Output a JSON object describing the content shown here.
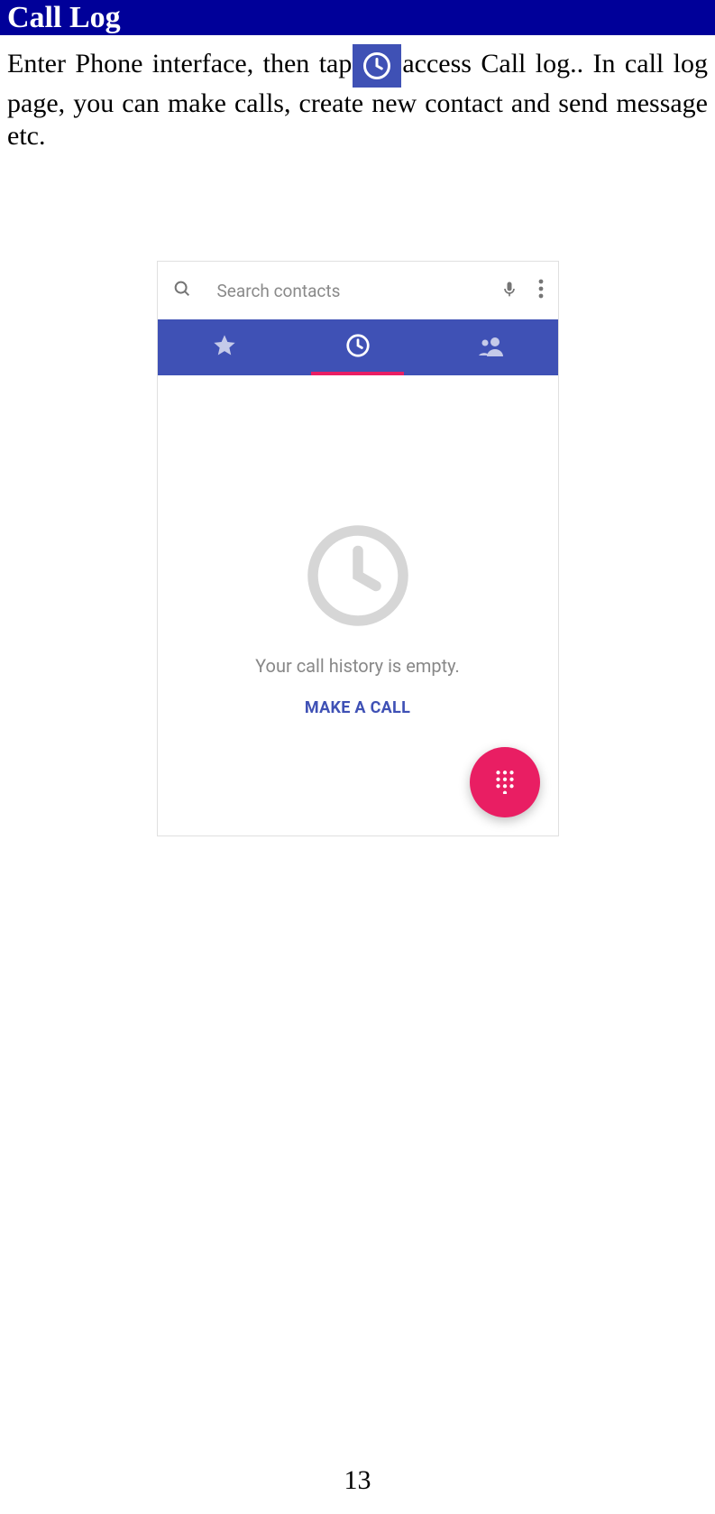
{
  "header_title": "Call Log",
  "body": {
    "part1": "Enter Phone interface, then tap",
    "part2": "access Call log.. In call log page, you can make calls, create new contact and send message etc."
  },
  "screenshot": {
    "search_placeholder": "Search contacts",
    "empty_title": "Your call history is empty.",
    "make_call_label": "MAKE A CALL"
  },
  "page_number": "13"
}
